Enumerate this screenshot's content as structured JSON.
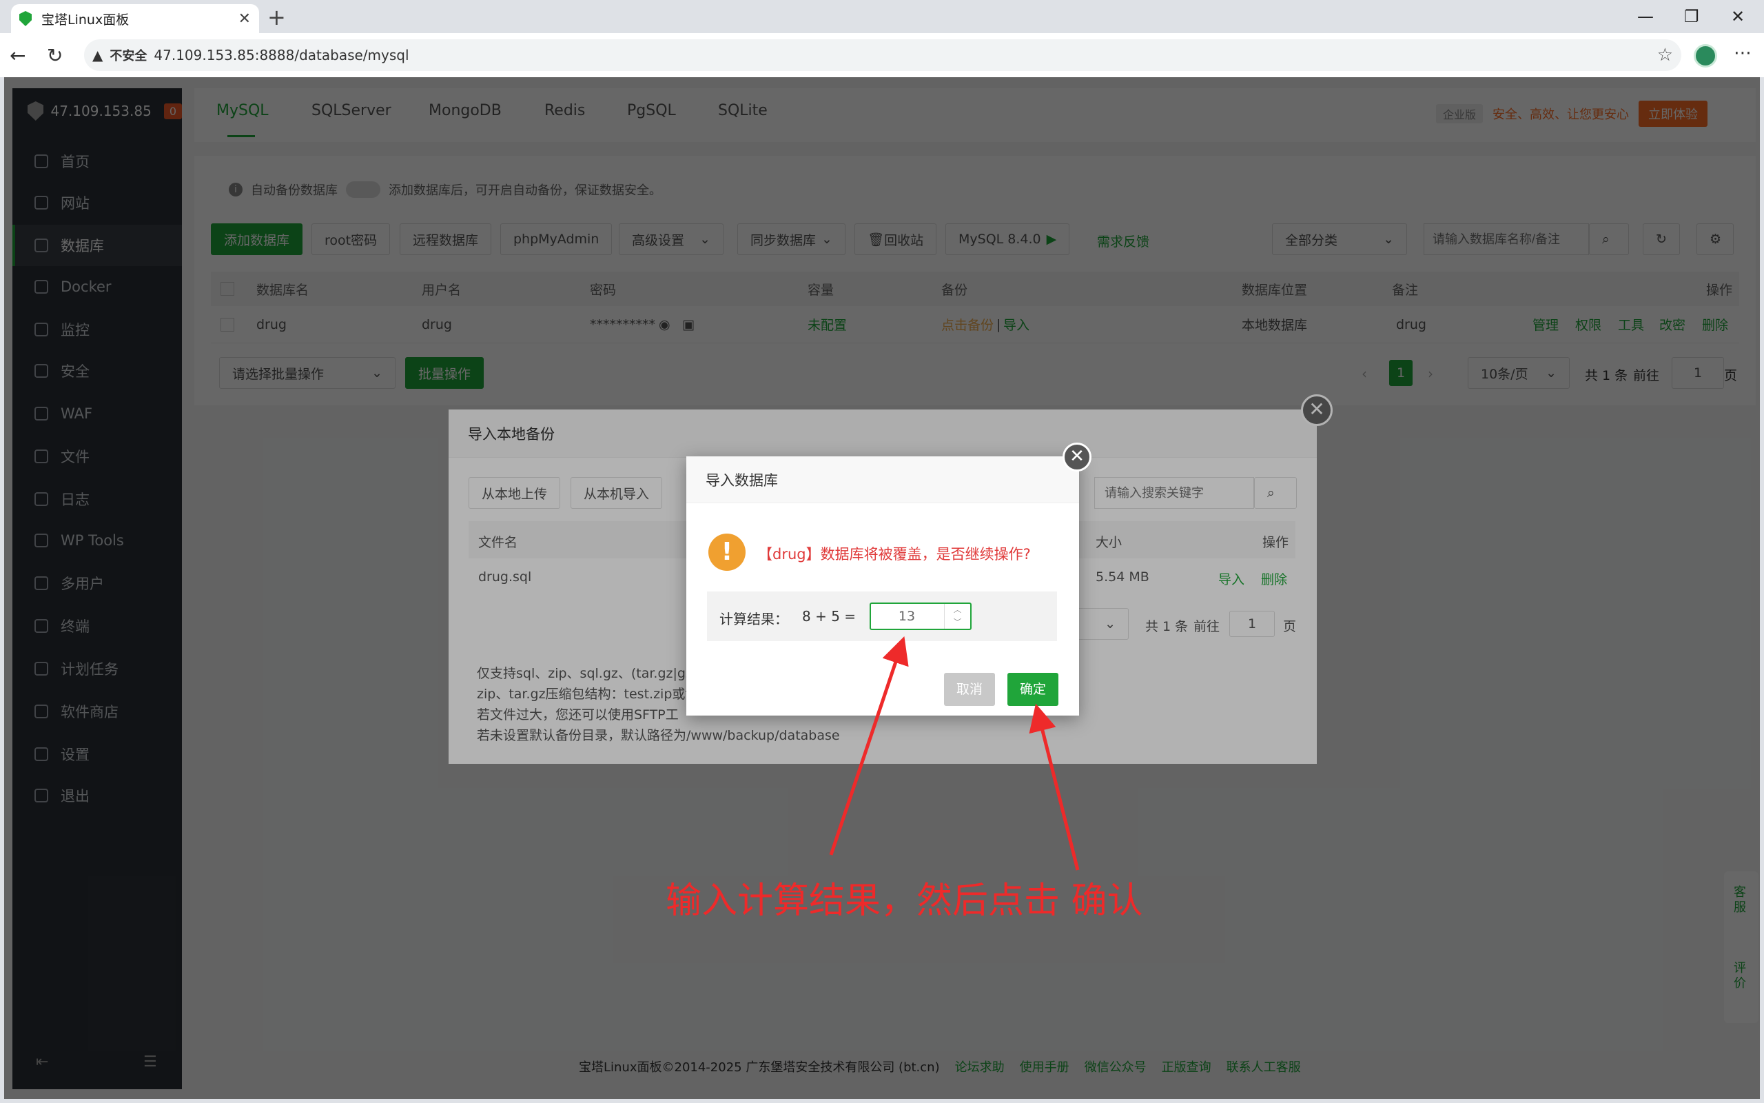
{
  "browser": {
    "tab_title": "宝塔Linux面板",
    "security_label": "不安全",
    "url": "47.109.153.85:8888/database/mysql"
  },
  "sidebar": {
    "host": "47.109.153.85",
    "badge": "0",
    "items": [
      {
        "label": "首页"
      },
      {
        "label": "网站"
      },
      {
        "label": "数据库"
      },
      {
        "label": "Docker"
      },
      {
        "label": "监控"
      },
      {
        "label": "安全"
      },
      {
        "label": "WAF"
      },
      {
        "label": "文件"
      },
      {
        "label": "日志"
      },
      {
        "label": "WP Tools"
      },
      {
        "label": "多用户"
      },
      {
        "label": "终端"
      },
      {
        "label": "计划任务"
      },
      {
        "label": "软件商店"
      },
      {
        "label": "设置"
      },
      {
        "label": "退出"
      }
    ]
  },
  "db_tabs": [
    "MySQL",
    "SQLServer",
    "MongoDB",
    "Redis",
    "PgSQL",
    "SQLite"
  ],
  "promo": {
    "tag": "企业版",
    "text": "安全、高效、让您更安心",
    "button": "立即体验"
  },
  "autobackup": {
    "label": "自动备份数据库",
    "hint": "添加数据库后，可开启自动备份，保证数据安全。"
  },
  "toolbar": {
    "add": "添加数据库",
    "root": "root密码",
    "remote": "远程数据库",
    "pma": "phpMyAdmin",
    "advanced": "高级设置",
    "sync": "同步数据库",
    "recycle": "回收站",
    "mysql_version": "MySQL 8.4.0",
    "feedback": "需求反馈",
    "category": "全部分类",
    "search_placeholder": "请输入数据库名称/备注"
  },
  "table": {
    "headers": {
      "name": "数据库名",
      "user": "用户名",
      "pwd": "密码",
      "cap": "容量",
      "backup": "备份",
      "loc": "数据库位置",
      "note": "备注",
      "ops": "操作"
    },
    "row": {
      "name": "drug",
      "user": "drug",
      "pwd": "**********",
      "cap": "未配置",
      "backup_click": "点击备份",
      "sep": "|",
      "backup_import": "导入",
      "loc": "本地数据库",
      "note": "drug",
      "ops": [
        "管理",
        "权限",
        "工具",
        "改密",
        "删除"
      ]
    }
  },
  "batch": {
    "select_placeholder": "请选择批量操作",
    "button": "批量操作"
  },
  "pager": {
    "current": "1",
    "per_page": "10条/页",
    "total": "共 1 条",
    "goto": "前往",
    "page_input": "1",
    "page_word": "页"
  },
  "import_dialog": {
    "title": "导入本地备份",
    "btn_upload": "从本地上传",
    "btn_machine": "从本机导入",
    "search_placeholder": "请输入搜索关键字",
    "col_file": "文件名",
    "col_size": "大小",
    "col_ops": "操作",
    "file": "drug.sql",
    "size": "5.54 MB",
    "op_import": "导入",
    "op_delete": "删除",
    "pager_total": "共 1 条",
    "pager_goto": "前往",
    "pager_input": "1",
    "pager_page": "页",
    "hints": [
      "仅支持sql、zip、sql.gz、(tar.gz|gz",
      "zip、tar.gz压缩包结构：test.zip或t",
      "若文件过大，您还可以使用SFTP工",
      "若未设置默认备份目录，默认路径为/www/backup/database"
    ]
  },
  "confirm_dialog": {
    "title": "导入数据库",
    "message": "【drug】数据库将被覆盖，是否继续操作?",
    "calc_label": "计算结果：",
    "expression": "8 + 5  =",
    "answer": "13",
    "cancel": "取消",
    "ok": "确定"
  },
  "annotation": "输入计算结果，然后点击 确认",
  "footer": {
    "copyright": "宝塔Linux面板©2014-2025 广东堡塔安全技术有限公司 (bt.cn)",
    "links": [
      "论坛求助",
      "使用手册",
      "微信公众号",
      "正版查询",
      "联系人工客服"
    ]
  },
  "side_widget": {
    "service": "客服",
    "review": "评价"
  },
  "colors": {
    "brand": "#20a53a",
    "danger": "#e03a3a",
    "annotation": "#ee2a2a"
  }
}
